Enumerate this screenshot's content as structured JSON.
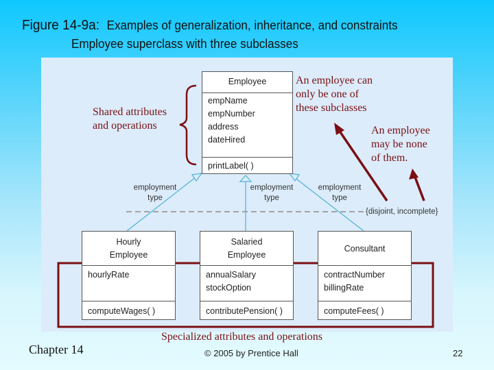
{
  "slide": {
    "title_main": "Figure 14-9a:",
    "title_rest": "Examples of generalization, inheritance, and constraints",
    "subtitle": "Employee superclass with three subclasses"
  },
  "superclass": {
    "name": "Employee",
    "attributes": [
      "empName",
      "empNumber",
      "address",
      "dateHired"
    ],
    "operations": [
      "printLabel( )"
    ]
  },
  "subclasses": [
    {
      "name_lines": [
        "Hourly",
        "Employee"
      ],
      "attributes": [
        "hourlyRate"
      ],
      "operations": [
        "computeWages( )"
      ]
    },
    {
      "name_lines": [
        "Salaried",
        "Employee"
      ],
      "attributes": [
        "annualSalary",
        "stockOption"
      ],
      "operations": [
        "contributePension( )"
      ]
    },
    {
      "name_lines": [
        "Consultant"
      ],
      "attributes": [
        "contractNumber",
        "billingRate"
      ],
      "operations": [
        "computeFees( )"
      ]
    }
  ],
  "discriminator_labels": [
    {
      "line1": "employment",
      "line2": "type"
    },
    {
      "line1": "employment",
      "line2": "type"
    },
    {
      "line1": "employment",
      "line2": "type"
    }
  ],
  "constraint": "{disjoint, incomplete}",
  "annotations": {
    "shared": [
      "Shared attributes",
      "and operations"
    ],
    "disjoint": [
      "An employee can",
      "only be one of",
      "these subclasses"
    ],
    "incomplete": [
      "An employee",
      "may be none",
      "of them."
    ],
    "specialized": "Specialized attributes and operations"
  },
  "footer": {
    "chapter": "Chapter 14",
    "copyright": "© 2005 by Prentice Hall",
    "page": "22"
  },
  "colors": {
    "annotation": "#7a0f14",
    "connector": "#4fb0d6",
    "panel": "#dcecfa"
  }
}
